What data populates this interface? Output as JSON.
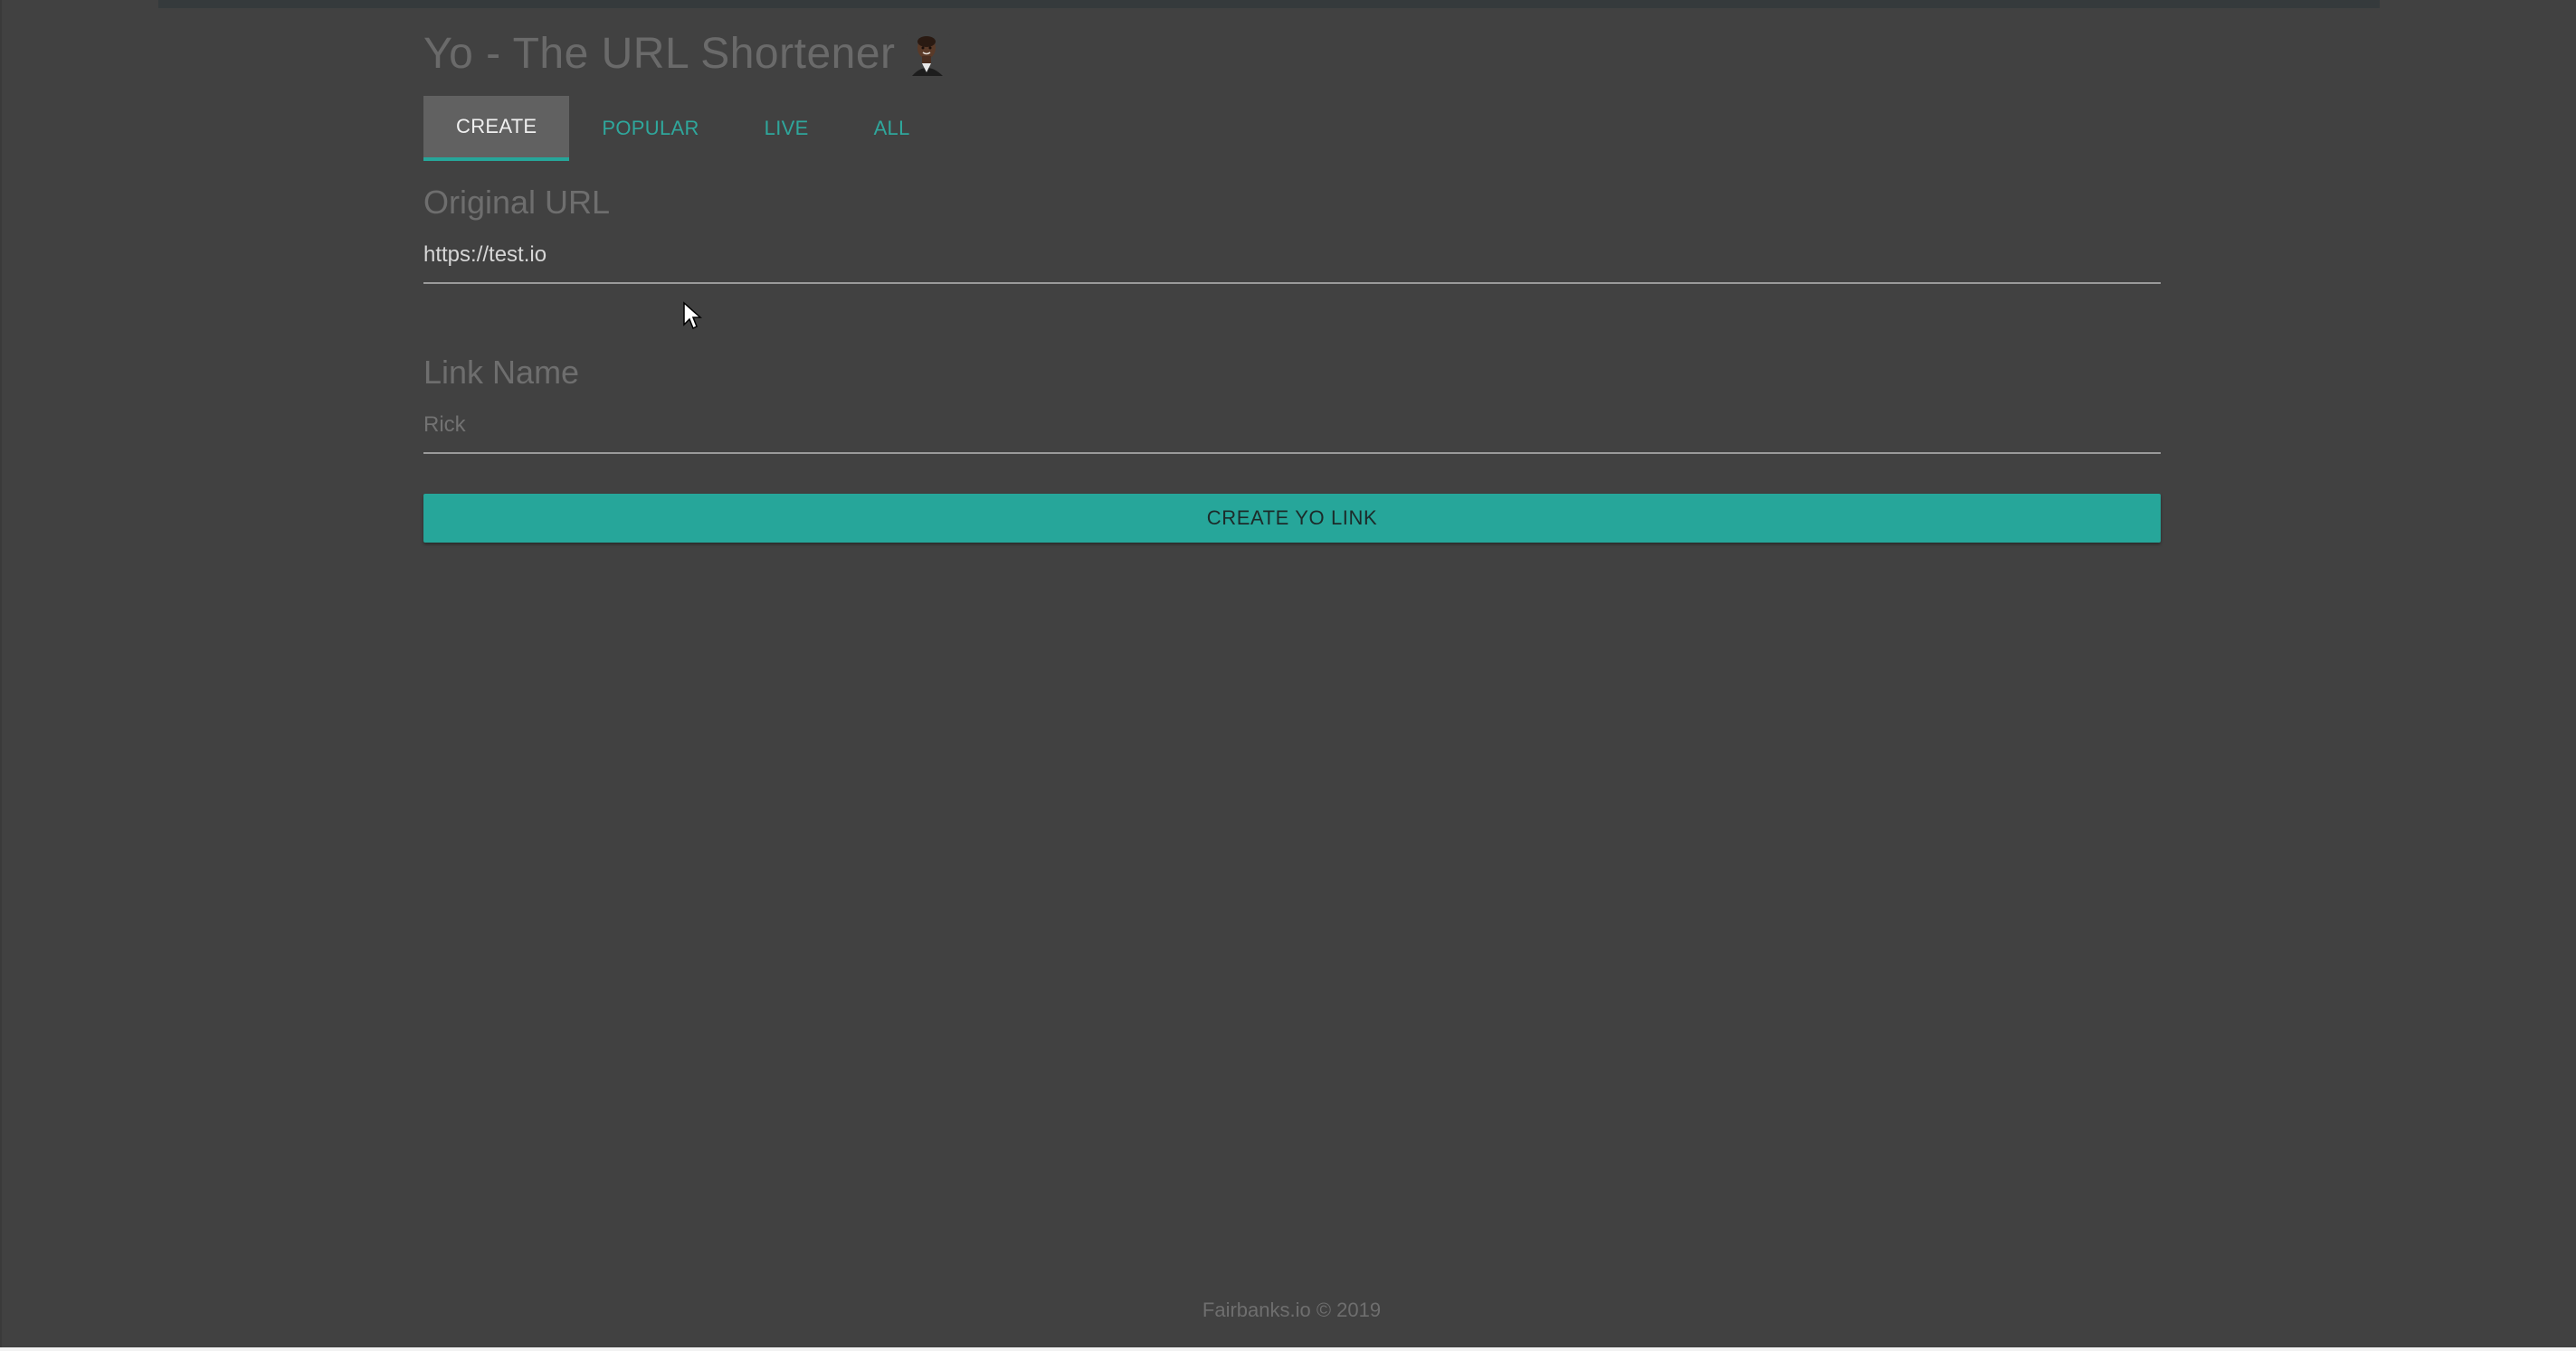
{
  "header": {
    "title": "Yo - The URL Shortener",
    "avatar_icon": "user-avatar-icon"
  },
  "tabs": [
    {
      "label": "CREATE",
      "active": true
    },
    {
      "label": "POPULAR",
      "active": false
    },
    {
      "label": "LIVE",
      "active": false
    },
    {
      "label": "ALL",
      "active": false
    }
  ],
  "form": {
    "original_url": {
      "label": "Original URL",
      "value": "https://test.io",
      "placeholder": ""
    },
    "link_name": {
      "label": "Link Name",
      "value": "",
      "placeholder": "Rick"
    },
    "submit_label": "CREATE YO LINK"
  },
  "footer": {
    "text": "Fairbanks.io © 2019"
  },
  "colors": {
    "background": "#414141",
    "accent": "#26a69a",
    "active_tab_bg": "#616161"
  }
}
